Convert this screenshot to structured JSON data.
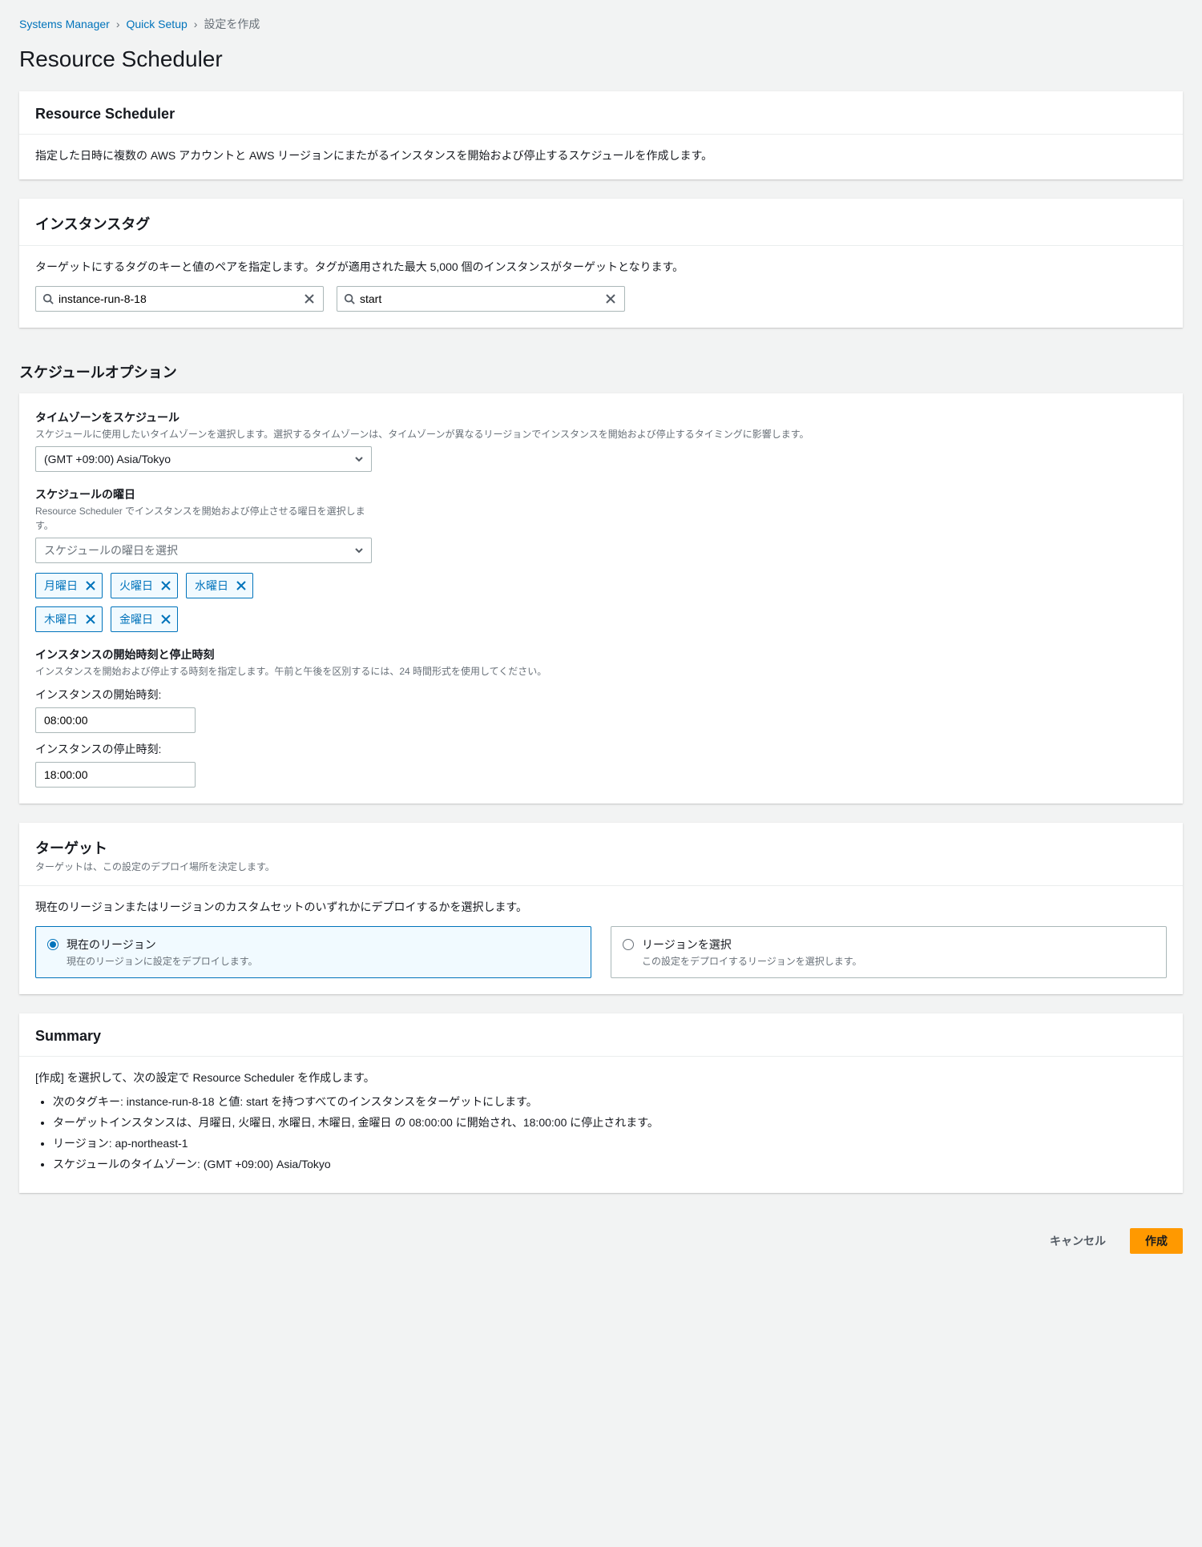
{
  "breadcrumb": {
    "l1": "Systems Manager",
    "l2": "Quick Setup",
    "current": "設定を作成"
  },
  "page_title": "Resource Scheduler",
  "panel1": {
    "title": "Resource Scheduler",
    "desc": "指定した日時に複数の AWS アカウントと AWS リージョンにまたがるインスタンスを開始および停止するスケジュールを作成します。"
  },
  "panel_tags": {
    "title": "インスタンスタグ",
    "desc": "ターゲットにするタグのキーと値のペアを指定します。タグが適用された最大 5,000 個のインスタンスがターゲットとなります。",
    "key_value": "instance-run-8-18",
    "val_value": "start"
  },
  "schedule": {
    "section_title": "スケジュールオプション",
    "tz_label": "タイムゾーンをスケジュール",
    "tz_hint": "スケジュールに使用したいタイムゾーンを選択します。選択するタイムゾーンは、タイムゾーンが異なるリージョンでインスタンスを開始および停止するタイミングに影響します。",
    "tz_value": "(GMT +09:00) Asia/Tokyo",
    "days_label": "スケジュールの曜日",
    "days_hint": "Resource Scheduler でインスタンスを開始および停止させる曜日を選択します。",
    "days_placeholder": "スケジュールの曜日を選択",
    "days": [
      "月曜日",
      "火曜日",
      "水曜日",
      "木曜日",
      "金曜日"
    ],
    "times_label": "インスタンスの開始時刻と停止時刻",
    "times_hint": "インスタンスを開始および停止する時刻を指定します。午前と午後を区別するには、24 時間形式を使用してください。",
    "start_label": "インスタンスの開始時刻:",
    "start_value": "08:00:00",
    "stop_label": "インスタンスの停止時刻:",
    "stop_value": "18:00:00"
  },
  "targets": {
    "title": "ターゲット",
    "sub": "ターゲットは、この設定のデプロイ場所を決定します。",
    "desc": "現在のリージョンまたはリージョンのカスタムセットのいずれかにデプロイするかを選択します。",
    "opt1_title": "現在のリージョン",
    "opt1_sub": "現在のリージョンに設定をデプロイします。",
    "opt2_title": "リージョンを選択",
    "opt2_sub": "この設定をデプロイするリージョンを選択します。"
  },
  "summary": {
    "title": "Summary",
    "lead": "[作成] を選択して、次の設定で Resource Scheduler を作成します。",
    "li1": "次のタグキー: instance-run-8-18 と値: start を持つすべてのインスタンスをターゲットにします。",
    "li2": "ターゲットインスタンスは、月曜日, 火曜日, 水曜日, 木曜日, 金曜日 の 08:00:00 に開始され、18:00:00 に停止されます。",
    "li3": "リージョン: ap-northeast-1",
    "li4": "スケジュールのタイムゾーン: (GMT +09:00) Asia/Tokyo"
  },
  "footer": {
    "cancel": "キャンセル",
    "create": "作成"
  }
}
